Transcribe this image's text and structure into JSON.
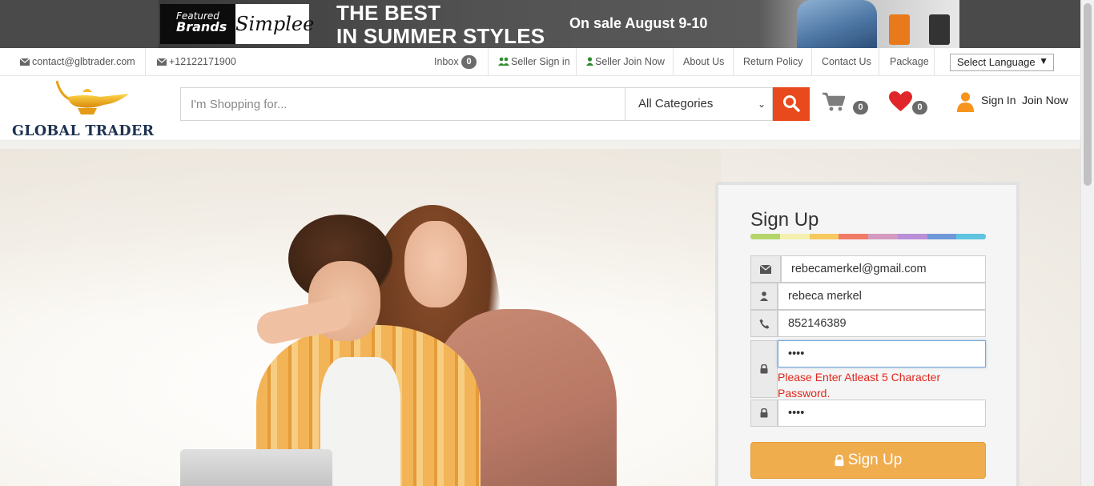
{
  "banner": {
    "featured_line1": "Featured",
    "featured_line2": "Brands",
    "brand_name": "Simplee",
    "headline_line1": "THE BEST",
    "headline_line2": "IN SUMMER STYLES",
    "sale_text": "On sale August 9-10"
  },
  "topbar": {
    "email": "contact@glbtrader.com",
    "phone": "+12122171900",
    "inbox_label": "Inbox",
    "inbox_count": "0",
    "seller_signin": "Seller Sign in",
    "seller_join": "Seller Join Now",
    "about": "About Us",
    "return_policy": "Return Policy",
    "contact": "Contact Us",
    "package": "Package",
    "language": "Select Language"
  },
  "header": {
    "logo_text": "GLOBAL TRADER",
    "search_placeholder": "I'm Shopping for...",
    "category_selected": "All Categories",
    "cart_count": "0",
    "wishlist_count": "0",
    "signin": "Sign In",
    "joinnow": "Join Now"
  },
  "signup": {
    "title": "Sign Up",
    "rainbow_colors": [
      "#b5d56a",
      "#f4f0b0",
      "#f7c95f",
      "#ef7b66",
      "#d49ac0",
      "#b98fd8",
      "#6f98d9",
      "#5fc4e0"
    ],
    "email_value": "rebecamerkel@gmail.com",
    "name_value": "rebeca merkel",
    "phone_value": "852146389",
    "password_value": "••••",
    "password_error": "Please Enter Atleast 5 Character Password.",
    "confirm_value": "••••",
    "button_label": "Sign Up"
  },
  "colors": {
    "accent_orange": "#f0ad4e",
    "search_button": "#e8491d",
    "heart_red": "#e0262b",
    "person_orange": "#f7941d",
    "error_red": "#e0261b"
  },
  "icons": {
    "email": "envelope-icon",
    "user": "user-icon",
    "phone": "phone-icon",
    "password": "lock-icon",
    "cart": "cart-icon",
    "wishlist": "heart-icon",
    "account": "person-icon",
    "search": "search-icon"
  }
}
